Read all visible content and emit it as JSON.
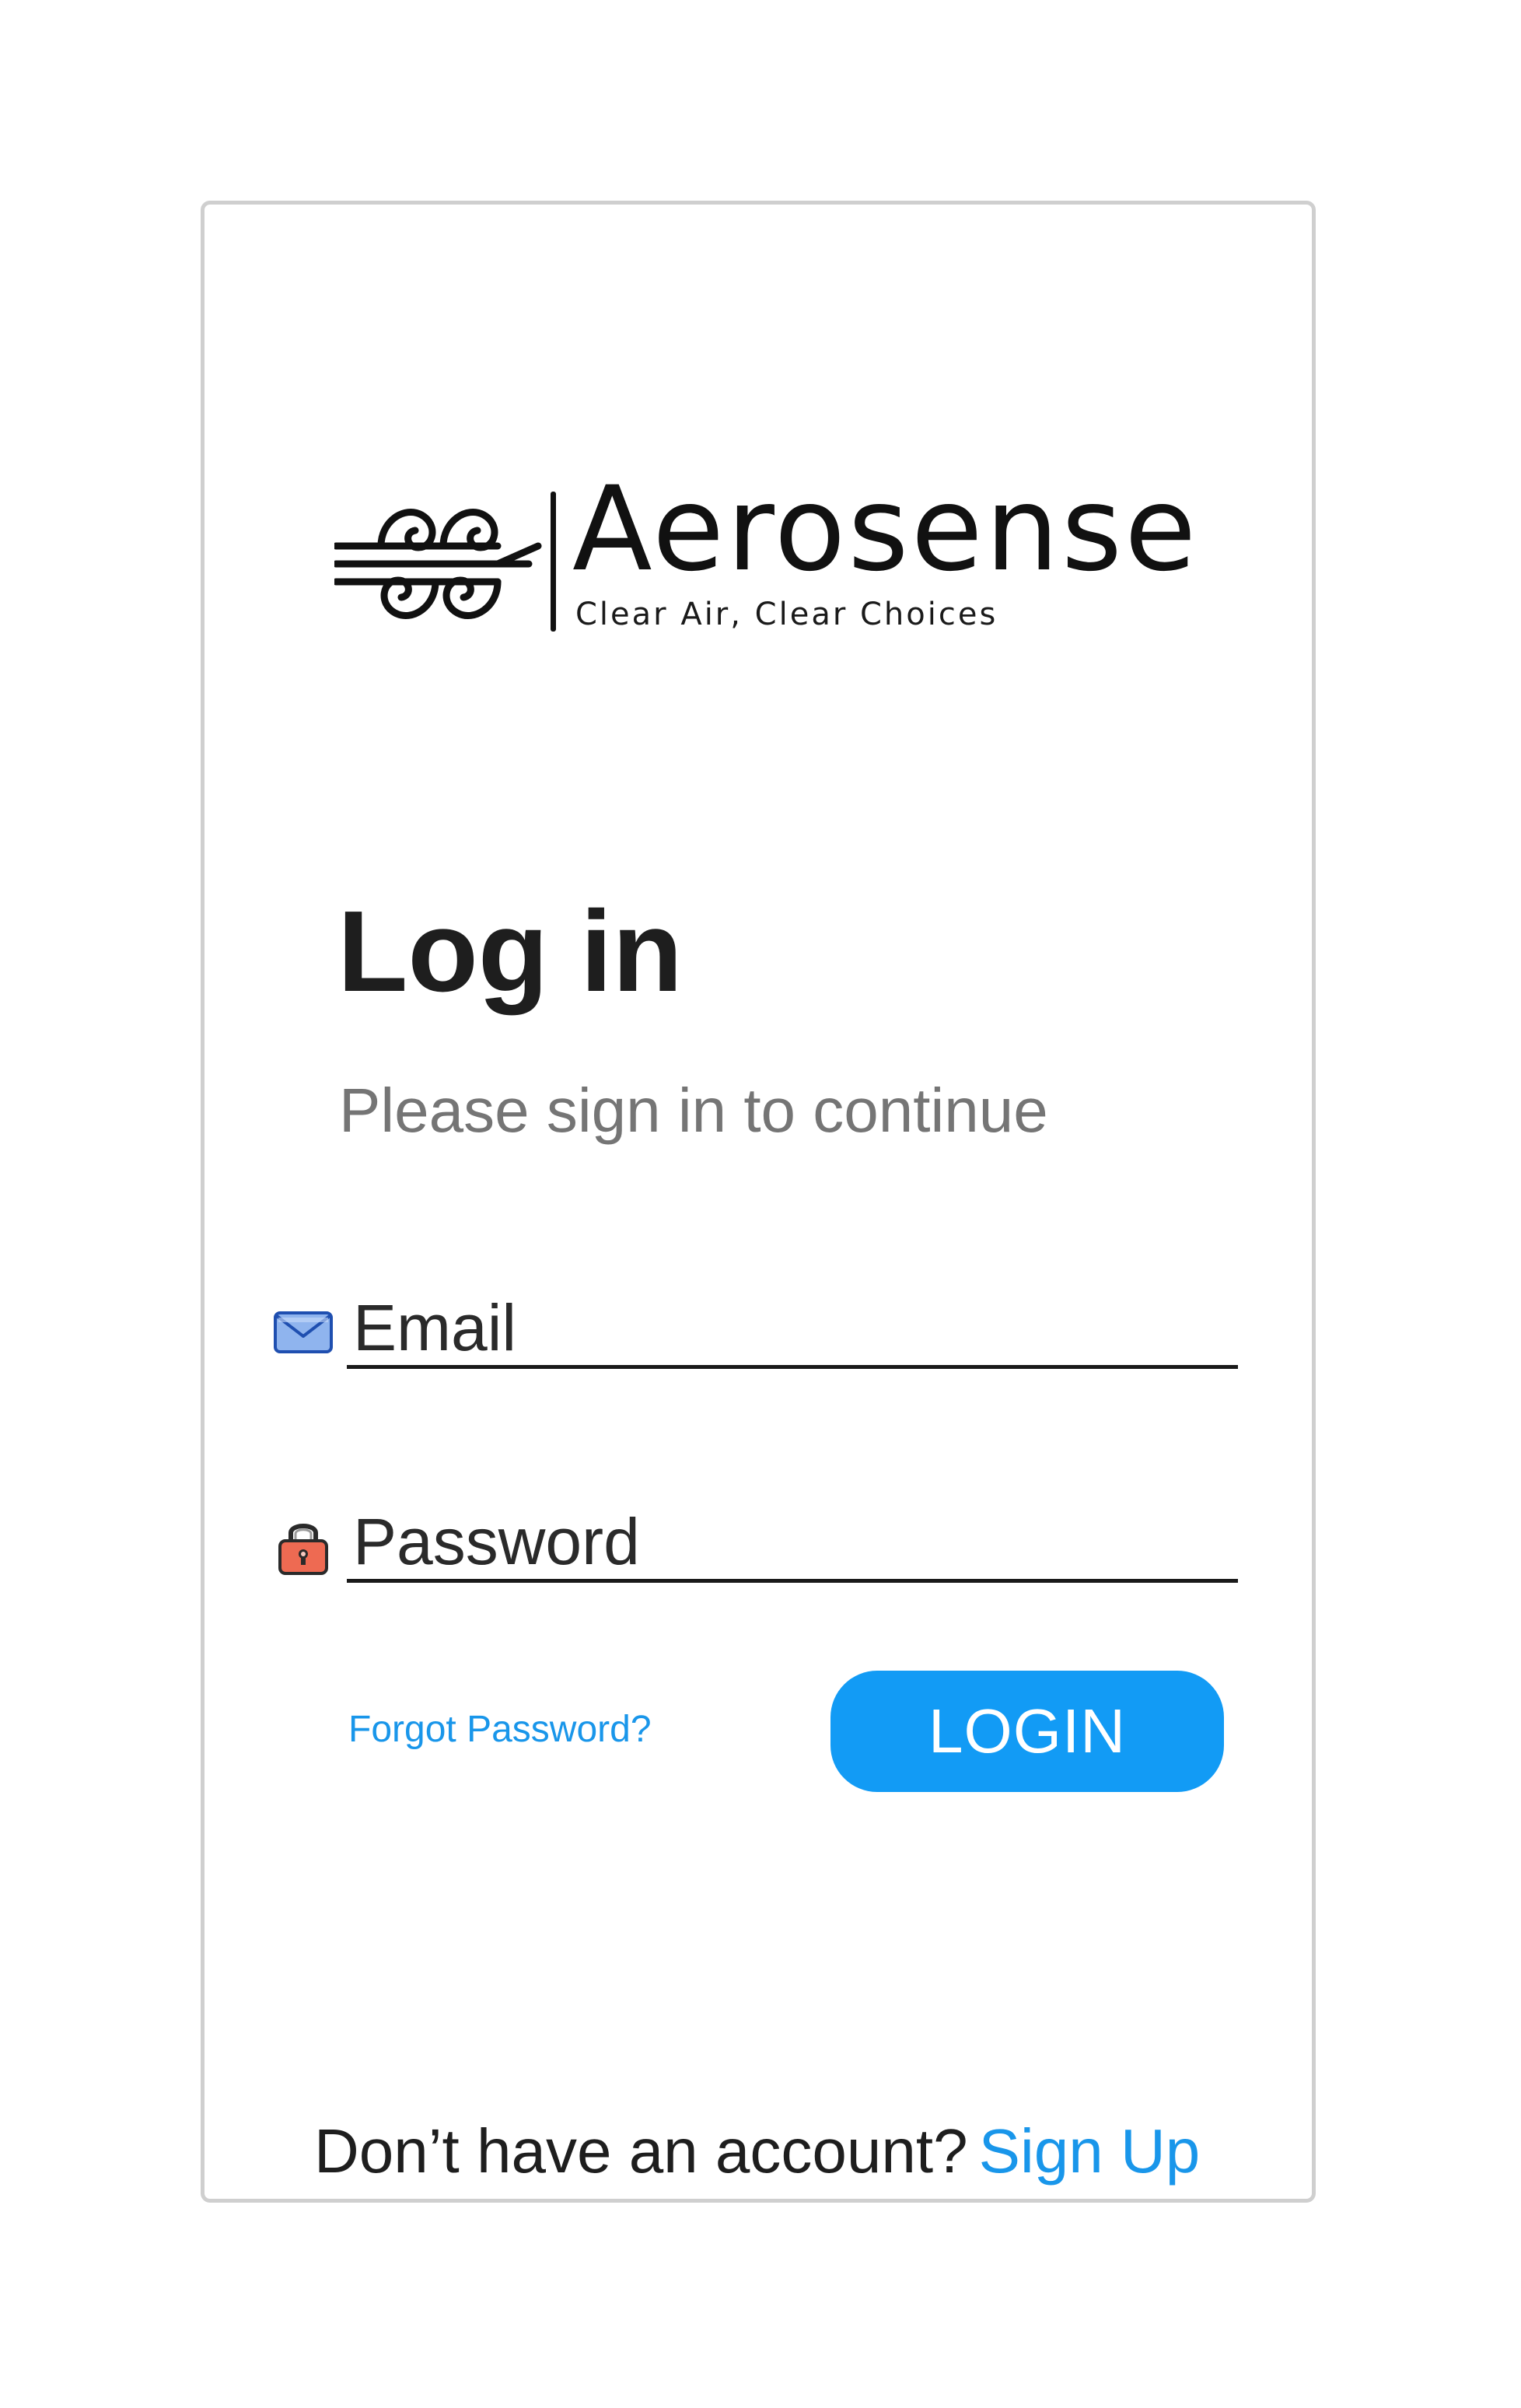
{
  "brand": {
    "name": "Aerosense",
    "tagline": "Clear Air, Clear Choices",
    "logo_icon": "wind-swirl-icon"
  },
  "heading": {
    "title": "Log in",
    "subtitle": "Please sign in to continue"
  },
  "form": {
    "email": {
      "placeholder": "Email",
      "value": "",
      "icon": "envelope-icon"
    },
    "password": {
      "placeholder": "Password",
      "value": "",
      "icon": "lock-icon"
    },
    "forgot_label": "Forgot Password?",
    "login_label": "LOGIN"
  },
  "footer": {
    "prompt": "Don’t have an account?",
    "signup_label": "Sign Up"
  },
  "colors": {
    "accent": "#129bf5",
    "link": "#1996ea",
    "title": "#1e1e1e",
    "subtitle": "#757575",
    "frame_border": "#cfcfcf"
  }
}
